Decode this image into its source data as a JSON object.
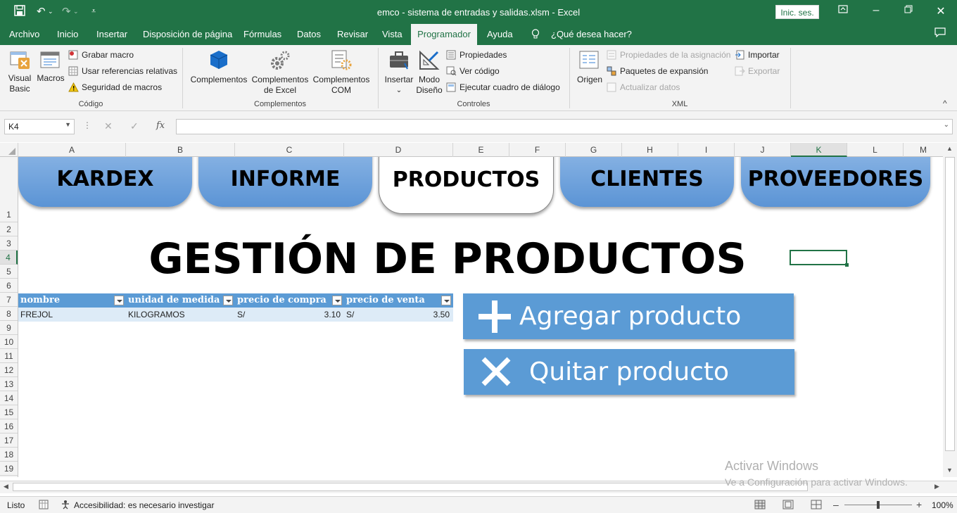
{
  "window": {
    "title": "emco - sistema de entradas y salidas.xlsm  -  Excel",
    "sign_in": "Inic. ses."
  },
  "ribbon_tabs": [
    "Archivo",
    "Inicio",
    "Insertar",
    "Disposición de página",
    "Fórmulas",
    "Datos",
    "Revisar",
    "Vista",
    "Programador",
    "Ayuda"
  ],
  "active_tab": "Programador",
  "tell_me": "¿Qué desea hacer?",
  "ribbon": {
    "codigo": {
      "group_label": "Código",
      "visual_basic": "Visual Basic",
      "macros": "Macros",
      "grabar_macro": "Grabar macro",
      "usar_refs": "Usar referencias relativas",
      "seguridad": "Seguridad de macros"
    },
    "complementos": {
      "group_label": "Complementos",
      "complementos": "Complementos",
      "complementos_excel": "Complementos de Excel",
      "complementos_com": "Complementos COM"
    },
    "controles": {
      "group_label": "Controles",
      "insertar": "Insertar",
      "modo_diseno": "Modo Diseño",
      "propiedades": "Propiedades",
      "ver_codigo": "Ver código",
      "ejecutar": "Ejecutar cuadro de diálogo"
    },
    "xml": {
      "group_label": "XML",
      "origen": "Origen",
      "prop_asignacion": "Propiedades de la asignación",
      "paquetes": "Paquetes de expansión",
      "actualizar": "Actualizar datos",
      "importar": "Importar",
      "exportar": "Exportar"
    }
  },
  "formula_bar": {
    "name_box": "K4",
    "fx": "fx",
    "value": ""
  },
  "columns": [
    "A",
    "B",
    "C",
    "D",
    "E",
    "F",
    "G",
    "H",
    "I",
    "J",
    "K",
    "L",
    "M"
  ],
  "rows": [
    "1",
    "2",
    "3",
    "4",
    "5",
    "6",
    "7",
    "8",
    "9",
    "10",
    "11",
    "12",
    "13",
    "14",
    "15",
    "16",
    "17",
    "18",
    "19"
  ],
  "sheet": {
    "nav_tabs": [
      "KARDEX",
      "INFORME",
      "PRODUCTOS",
      "CLIENTES",
      "PROVEEDORES"
    ],
    "active_nav": "PRODUCTOS",
    "title": "GESTIÓN DE PRODUCTOS",
    "table": {
      "headers": [
        "nombre",
        "unidad de medida",
        "precio de compra",
        "precio de venta"
      ],
      "rows": [
        {
          "nombre": "FREJOL",
          "unidad": "KILOGRAMOS",
          "compra_cur": "S/",
          "compra": "3.10",
          "venta_cur": "S/",
          "venta": "3.50"
        }
      ]
    },
    "add_button": "Agregar producto",
    "remove_button": "Quitar producto"
  },
  "watermark": {
    "line1": "Activar Windows",
    "line2": "Ve a Configuración para activar Windows."
  },
  "status": {
    "ready": "Listo",
    "accessibility": "Accesibilidad: es necesario investigar",
    "zoom": "100%"
  },
  "colors": {
    "excel_green": "#217346",
    "button_blue": "#5b9bd5",
    "table_row": "#ddebf7"
  }
}
